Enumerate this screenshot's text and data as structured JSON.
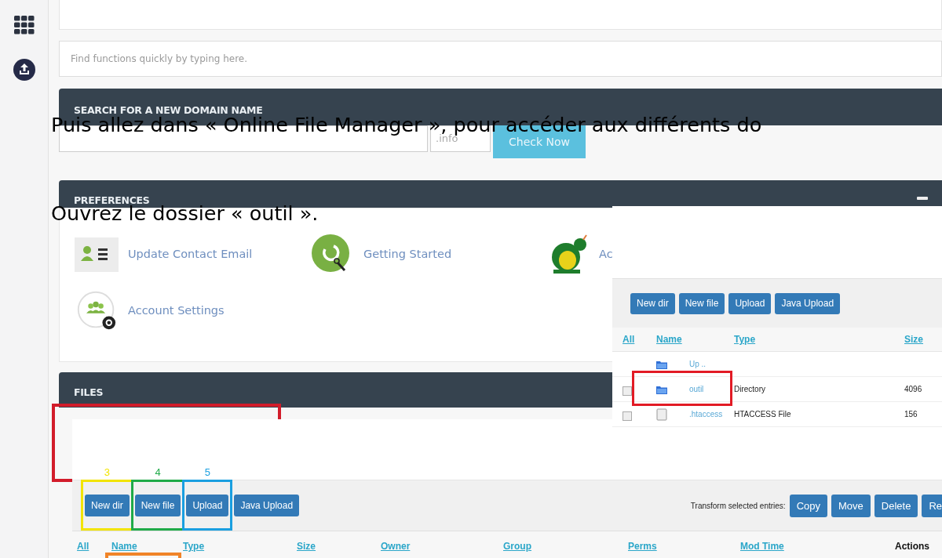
{
  "search": {
    "placeholder": "Find functions quickly by typing here."
  },
  "domain_panel": {
    "title": "SEARCH FOR A NEW DOMAIN NAME",
    "extension": ".info",
    "button": "Check Now"
  },
  "preferences_panel": {
    "title": "PREFERENCES",
    "items": [
      {
        "label": "Update Contact Email",
        "kind": "contact"
      },
      {
        "label": "Getting Started",
        "kind": "start"
      },
      {
        "label": "Ac",
        "kind": "dragon"
      },
      {
        "label": "Account Settings",
        "kind": "account"
      }
    ]
  },
  "files_panel": {
    "title": "FILES",
    "highlighted": true
  },
  "instructions": [
    "Puis allez dans « Online File Manager », pour accéder aux différents do",
    "Ouvrez le dossier « outil »."
  ],
  "file_manager_detail": {
    "buttons": [
      "New dir",
      "New file",
      "Upload",
      "Java Upload"
    ],
    "columns": [
      "All",
      "Name",
      "Type",
      "Size"
    ],
    "rows": [
      {
        "kind": "up",
        "name": "Up ..",
        "type": "",
        "size": "",
        "highlighted": false
      },
      {
        "kind": "folder",
        "name": "outil",
        "type": "Directory",
        "size": "4096",
        "checked": false,
        "highlighted": true
      },
      {
        "kind": "file",
        "name": ".htaccess",
        "type": "HTACCESS File",
        "size": "156",
        "checked": false,
        "highlighted": false
      }
    ]
  },
  "file_manager": {
    "buttons": [
      {
        "label": "New dir",
        "marker": "3",
        "color": "#f2e400"
      },
      {
        "label": "New file",
        "marker": "4",
        "color": "#1faa48"
      },
      {
        "label": "Upload",
        "marker": "5",
        "color": "#1a9fe0"
      },
      {
        "label": "Java Upload"
      }
    ],
    "transform_label": "Transform selected entries:",
    "transform_buttons": [
      "Copy",
      "Move",
      "Delete",
      "Re"
    ],
    "columns": [
      {
        "label": "All",
        "kind": "link",
        "marked": false
      },
      {
        "label": "Name",
        "kind": "link",
        "marked": true
      },
      {
        "label": "Type",
        "kind": "link",
        "marked": false
      },
      {
        "label": "Size",
        "kind": "link",
        "marked": false
      },
      {
        "label": "Owner",
        "kind": "link",
        "marked": false
      },
      {
        "label": "Group",
        "kind": "link",
        "marked": false
      },
      {
        "label": "Perms",
        "kind": "link",
        "marked": false
      },
      {
        "label": "Mod Time",
        "kind": "link",
        "marked": false
      },
      {
        "label": "Actions",
        "kind": "plain",
        "marked": false
      }
    ]
  }
}
